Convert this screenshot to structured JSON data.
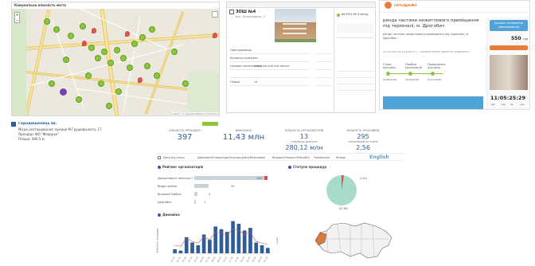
{
  "map_panel": {
    "title": "Комунальна власність міста",
    "attribution": "Leaflet | © OpenStreetMap contributors",
    "owner_name": "Городищенець Ш.",
    "owner_line1": "Місце розташування: вулиця М.Грушевського, 17",
    "owner_line2": "Орендар: ФО \"Федорук\"",
    "owner_line3": "Площа: 396.5 м",
    "zoom_in": "+",
    "zoom_out": "−"
  },
  "object_card": {
    "title": "ЗОШ №4",
    "subtitle": "вул. Біляшкевича, 4",
    "rows": [
      {
        "label": "Орендодавець",
        "value": ""
      },
      {
        "label": "Балансоутримувач",
        "value": ""
      },
      {
        "label": "Цільове призначення",
        "value": "Надання освітніх послуг"
      },
      {
        "label": "Площа",
        "value": "14"
      }
    ],
    "badge": "66.55% 65.5 м/год"
  },
  "auction_header": {
    "brand": "ПРОДАЖІ",
    "title": "ренда частини нежитлового приміщення під терміналі, м. Дрогобич",
    "desc": "ренда частини нежитлового приміщення під терміналі, м. Дрогобич",
    "code": "UA-PS-2019-09-19-000076-3 • ЗАБЕЗПЕЧЕННЯ ОФЕРТОЮ ЗАВЕРШЕНО",
    "stages": [
      "Старт аукціону",
      "Прийом пропозицій",
      "Проведення аукціону"
    ],
    "stage_dates": [
      "19.09.2019",
      "19.09.2019",
      "03.10.2019"
    ],
    "status_button": "Аукціон оголошено (заплановано)",
    "price": "550",
    "price_unit": "грн",
    "timer": "11:05:25:29",
    "timer_units": [
      "дні",
      "год",
      "хв",
      "сек"
    ]
  },
  "stats": [
    {
      "label": "КІЛЬКІСТЬ ПРОЦЕДУР",
      "value": "397"
    },
    {
      "label": "ВИКОНАНО",
      "value": "11,43 млн"
    },
    {
      "label": "КІЛЬКІСТЬ ОРГАНІЗАТОРІВ",
      "value": "13"
    },
    {
      "label": "КІЛЬКІСТЬ УЧАСНИКІВ",
      "value": "295"
    }
  ],
  "stats_sub": [
    {
      "label": "ОЧІКУВАНА ВАРТІСТЬ",
      "value": "280,12 млн"
    },
    {
      "label": "ПРОПОЗИЦІЙ НА ТОРГИ",
      "value": "2,56"
    }
  ],
  "filters": {
    "label": "Дата від кінця",
    "chips": [
      "Державні/Оператори",
      "Консорціумні/Незалежні",
      "Відкриті/Закриті(Непубл)",
      "Поповнено",
      "Кінець"
    ],
    "language": "English"
  },
  "org_chart": {
    "title": "Рейтинг організаторів",
    "rows": [
      {
        "label": "Департамент власності",
        "value": "146"
      },
      {
        "label": "Відділ майна",
        "value": "29"
      },
      {
        "label": "Великий Любінь",
        "value": "4"
      },
      {
        "label": "Дрогобич",
        "value": "1"
      }
    ]
  },
  "status_chart": {
    "title": "Статуси процедур",
    "legend": "97.6%",
    "slice_label": "2.4%"
  },
  "dynamics_chart": {
    "title": "Динаміка",
    "ylabel_left": "Кількість процедур",
    "ylabel_right": "Сума"
  },
  "chart_data": {
    "type": "bar",
    "categories": [
      "01.18",
      "02.18",
      "03.18",
      "04.18",
      "05.18",
      "06.18",
      "07.18",
      "08.18",
      "09.18",
      "10.18",
      "11.18",
      "12.18",
      "01.19",
      "02.19",
      "03.19",
      "04.19",
      "05.19"
    ],
    "series": [
      {
        "values": [
          3,
          2,
          12,
          8,
          6,
          14,
          10,
          20,
          18,
          16,
          24,
          22,
          17,
          19,
          8,
          6,
          4
        ]
      }
    ],
    "title": "Динаміка",
    "xlabel": "",
    "ylabel": "Кількість процедур",
    "ylim": [
      0,
      25
    ]
  },
  "colors": {
    "accent_blue": "#2f5d9a",
    "card_blue": "#4fa3d9",
    "brand_orange": "#e87e39",
    "green": "#8cc63f"
  }
}
